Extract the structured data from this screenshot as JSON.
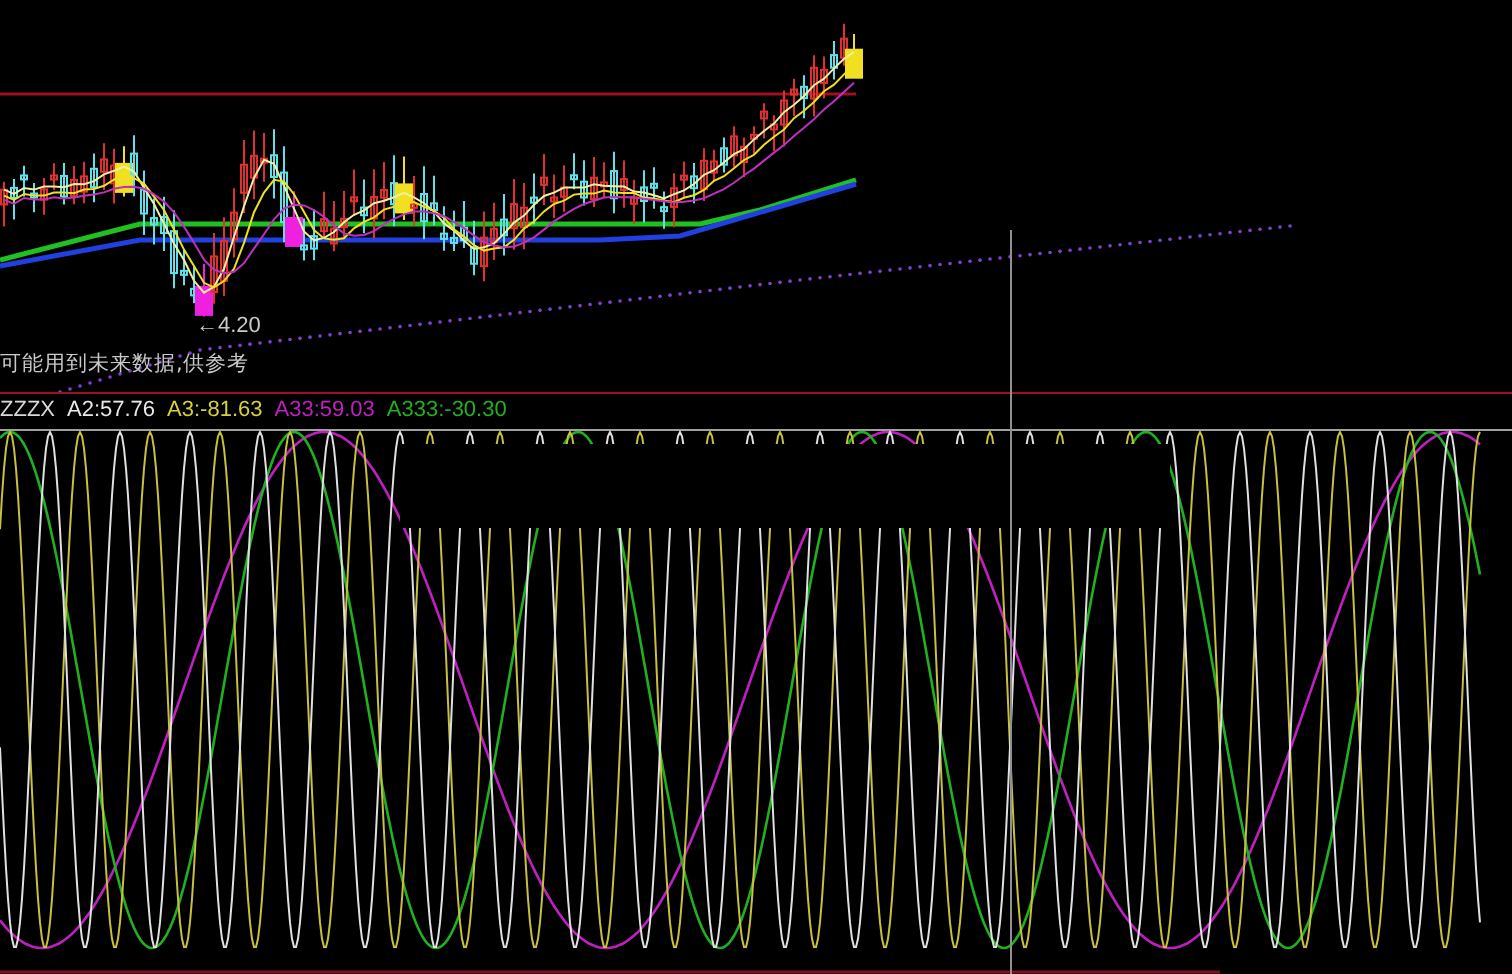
{
  "price_panel": {
    "low_label": "←4.20",
    "note": "可能用到未来数据,供参考"
  },
  "indicator_legend": [
    {
      "text": "ZZZX",
      "color": "#d8d8d8"
    },
    {
      "text": "A2:57.76",
      "color": "#e8e8e8"
    },
    {
      "text": "A3:-81.63",
      "color": "#d8d040"
    },
    {
      "text": "A33:59.03",
      "color": "#c020c0"
    },
    {
      "text": "A333:-30.30",
      "color": "#20b020"
    }
  ]
}
